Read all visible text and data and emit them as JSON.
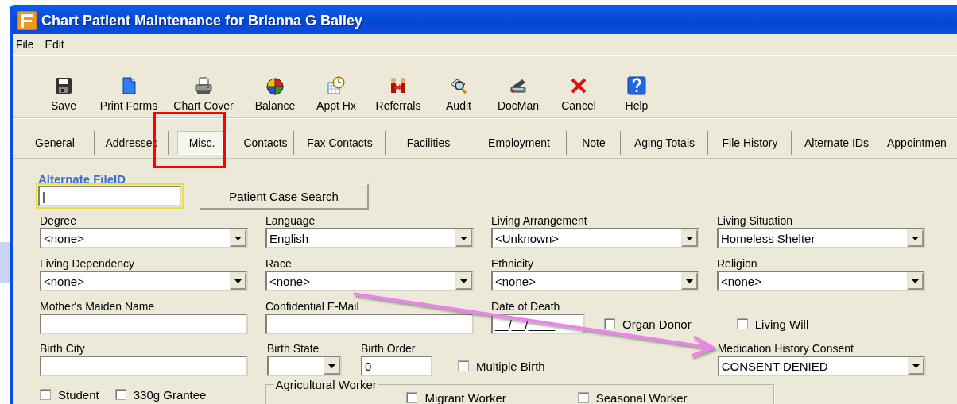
{
  "window": {
    "title": "Chart Patient Maintenance for Brianna G Bailey"
  },
  "menu": [
    "File",
    "Edit"
  ],
  "toolbar": [
    {
      "label": "Save"
    },
    {
      "label": "Print Forms"
    },
    {
      "label": "Chart Cover"
    },
    {
      "label": "Balance"
    },
    {
      "label": "Appt Hx"
    },
    {
      "label": "Referrals"
    },
    {
      "label": "Audit"
    },
    {
      "label": "DocMan"
    },
    {
      "label": "Cancel"
    },
    {
      "label": "Help"
    }
  ],
  "tabs": [
    {
      "label": "General",
      "selected": false
    },
    {
      "label": "Addresses",
      "selected": false
    },
    {
      "label": "Misc.",
      "selected": true
    },
    {
      "label": "Contacts",
      "selected": false
    },
    {
      "label": "Fax Contacts",
      "selected": false
    },
    {
      "label": "Facilities",
      "selected": false
    },
    {
      "label": "Employment",
      "selected": false
    },
    {
      "label": "Note",
      "selected": false
    },
    {
      "label": "Aging Totals",
      "selected": false
    },
    {
      "label": "File History",
      "selected": false
    },
    {
      "label": "Alternate IDs",
      "selected": false
    },
    {
      "label": "Appointmen",
      "selected": false
    }
  ],
  "form": {
    "fields": [
      {
        "kind": "text",
        "label": "Alternate FileID",
        "value": "|",
        "focused": true
      },
      {
        "kind": "button",
        "label": "Patient Case Search"
      },
      {
        "kind": "select",
        "label": "Degree",
        "value": "<none>"
      },
      {
        "kind": "select",
        "label": "Language",
        "value": "English"
      },
      {
        "kind": "select",
        "label": "Living Arrangement",
        "value": "<Unknown>"
      },
      {
        "kind": "select",
        "label": "Living Situation",
        "value": "Homeless Shelter"
      },
      {
        "kind": "select",
        "label": "Living Dependency",
        "value": "<none>"
      },
      {
        "kind": "select",
        "label": "Race",
        "value": "<none>"
      },
      {
        "kind": "select",
        "label": "Ethnicity",
        "value": "<none>"
      },
      {
        "kind": "select",
        "label": "Religion",
        "value": "<none>"
      },
      {
        "kind": "text",
        "label": "Mother's Maiden Name"
      },
      {
        "kind": "text",
        "label": "Confidential E-Mail"
      },
      {
        "kind": "text",
        "label": "Date of Death",
        "value": "__/__/____"
      },
      {
        "kind": "checkbox",
        "label": "Organ Donor",
        "checked": false
      },
      {
        "kind": "checkbox",
        "label": "Living Will",
        "checked": false
      },
      {
        "kind": "text",
        "label": "Birth City"
      },
      {
        "kind": "select",
        "label": "Birth State"
      },
      {
        "kind": "text",
        "label": "Birth Order",
        "value": "0"
      },
      {
        "kind": "checkbox",
        "label": "Multiple Birth",
        "checked": false
      },
      {
        "kind": "select",
        "label": "Medication History Consent",
        "value": "CONSENT DENIED"
      },
      {
        "kind": "checkbox",
        "label": "Student",
        "checked": false
      },
      {
        "kind": "checkbox",
        "label": "330g Grantee",
        "checked": false
      },
      {
        "kind": "group",
        "label": "Agricultural Worker",
        "items": [
          {
            "label": "Migrant Worker",
            "checked": false
          },
          {
            "label": "Seasonal Worker",
            "checked": false
          }
        ]
      }
    ]
  },
  "annotations": [
    {
      "kind": "highlight-box",
      "color": "#ff0000"
    },
    {
      "kind": "arrow",
      "color": "#f27ff2"
    }
  ]
}
